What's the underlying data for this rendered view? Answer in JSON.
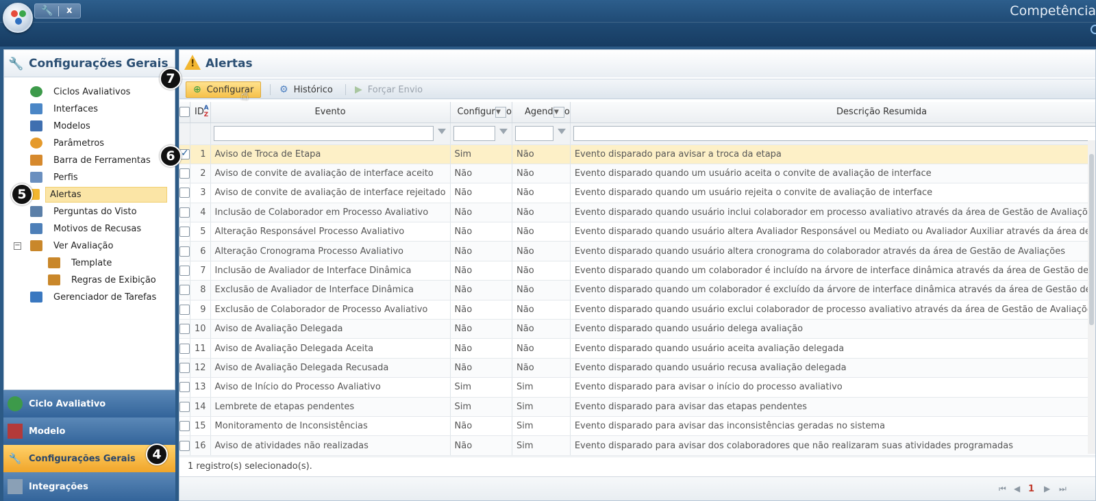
{
  "app": {
    "title": "Competência",
    "tab_close": "x"
  },
  "sidebar": {
    "title": "Configurações Gerais",
    "items": [
      {
        "label": "Ciclos Avaliativos",
        "icon": "cycle-icon",
        "color": "#3d9a4a"
      },
      {
        "label": "Interfaces",
        "icon": "pencil-doc-icon",
        "color": "#4a86c6"
      },
      {
        "label": "Modelos",
        "icon": "model-icon",
        "color": "#3f6fb0"
      },
      {
        "label": "Parâmetros",
        "icon": "pie-icon",
        "color": "#e59a2b"
      },
      {
        "label": "Barra de Ferramentas",
        "icon": "toolbox-icon",
        "color": "#d6892d"
      },
      {
        "label": "Perfis",
        "icon": "profile-icon",
        "color": "#6a8fbf"
      },
      {
        "label": "Alertas",
        "icon": "warning-icon",
        "color": "#f2b630"
      },
      {
        "label": "Perguntas do Visto",
        "icon": "question-doc-icon",
        "color": "#5b7fa8"
      },
      {
        "label": "Motivos de Recusas",
        "icon": "refuse-icon",
        "color": "#4d7fb8"
      },
      {
        "label": "Ver Avaliação",
        "icon": "clipboard-icon",
        "color": "#c9872a"
      },
      {
        "label": "Template",
        "icon": "clipboard-icon",
        "color": "#c9872a"
      },
      {
        "label": "Regras de Exibição",
        "icon": "clipboard-icon",
        "color": "#c9872a"
      },
      {
        "label": "Gerenciador de Tarefas",
        "icon": "task-manager-icon",
        "color": "#3a78c0"
      }
    ]
  },
  "accordion": [
    {
      "label": "Ciclo Avaliativo",
      "icon": "cycle-icon"
    },
    {
      "label": "Modelo",
      "icon": "books-icon"
    },
    {
      "label": "Configurações Gerais",
      "icon": "wrench-icon"
    },
    {
      "label": "Integrações",
      "icon": "integration-icon"
    }
  ],
  "main": {
    "title": "Alertas",
    "toolbar": {
      "configurar": "Configurar",
      "historico": "Histórico",
      "forcar_envio": "Forçar Envio"
    },
    "columns": {
      "id": "ID",
      "evento": "Evento",
      "configurado": "Configurado",
      "agendado": "Agendado",
      "descricao": "Descrição Resumida"
    },
    "rows": [
      {
        "id": "1",
        "evento": "Aviso de Troca de Etapa",
        "configurado": "Sim",
        "agendado": "Não",
        "descricao": "Evento disparado para avisar a troca da etapa",
        "checked": true
      },
      {
        "id": "2",
        "evento": "Aviso de convite de avaliação de interface aceito",
        "configurado": "Não",
        "agendado": "Não",
        "descricao": "Evento disparado quando um usuário aceita o convite de avaliação de interface"
      },
      {
        "id": "3",
        "evento": "Aviso de convite de avaliação de interface rejeitado",
        "configurado": "Não",
        "agendado": "Não",
        "descricao": "Evento disparado quando um usuário rejeita o convite de avaliação de interface"
      },
      {
        "id": "4",
        "evento": "Inclusão de Colaborador em Processo Avaliativo",
        "configurado": "Não",
        "agendado": "Não",
        "descricao": "Evento disparado quando usuário inclui colaborador em processo avaliativo através da área de Gestão de Avaliações"
      },
      {
        "id": "5",
        "evento": "Alteração Responsável Processo Avaliativo",
        "configurado": "Não",
        "agendado": "Não",
        "descricao": "Evento disparado quando usuário altera Avaliador Responsável ou Mediato ou Avaliador Auxiliar através da área de Gestão de Avaliações"
      },
      {
        "id": "6",
        "evento": "Alteração Cronograma Processo Avaliativo",
        "configurado": "Não",
        "agendado": "Não",
        "descricao": "Evento disparado quando usuário altera cronograma do colaborador através da área de Gestão de Avaliações"
      },
      {
        "id": "7",
        "evento": "Inclusão de Avaliador de Interface Dinâmica",
        "configurado": "Não",
        "agendado": "Não",
        "descricao": "Evento disparado quando um colaborador é incluído na árvore de interface dinâmica através da área de Gestão de Avaliações"
      },
      {
        "id": "8",
        "evento": "Exclusão de Avaliador de Interface Dinâmica",
        "configurado": "Não",
        "agendado": "Não",
        "descricao": "Evento disparado quando um colaborador é excluído da árvore de interface dinâmica através da área de Gestão de Avaliações"
      },
      {
        "id": "9",
        "evento": "Exclusão de Colaborador de Processo Avaliativo",
        "configurado": "Não",
        "agendado": "Não",
        "descricao": "Evento disparado quando usuário exclui colaborador de processo avaliativo através da área de Gestão de Avaliações"
      },
      {
        "id": "10",
        "evento": "Aviso de Avaliação Delegada",
        "configurado": "Não",
        "agendado": "Não",
        "descricao": "Evento disparado quando usuário delega avaliação"
      },
      {
        "id": "11",
        "evento": "Aviso de Avaliação Delegada Aceita",
        "configurado": "Não",
        "agendado": "Não",
        "descricao": "Evento disparado quando usuário aceita avaliação delegada"
      },
      {
        "id": "12",
        "evento": "Aviso de Avaliação Delegada Recusada",
        "configurado": "Não",
        "agendado": "Não",
        "descricao": "Evento disparado quando usuário recusa avaliação delegada"
      },
      {
        "id": "13",
        "evento": "Aviso de Início do Processo Avaliativo",
        "configurado": "Sim",
        "agendado": "Sim",
        "descricao": "Evento disparado para avisar o início do processo avaliativo"
      },
      {
        "id": "14",
        "evento": "Lembrete de etapas pendentes",
        "configurado": "Sim",
        "agendado": "Sim",
        "descricao": "Evento disparado para avisar das etapas pendentes"
      },
      {
        "id": "15",
        "evento": "Monitoramento de Inconsistências",
        "configurado": "Não",
        "agendado": "Sim",
        "descricao": "Evento disparado para avisar das inconsistências geradas no sistema"
      },
      {
        "id": "16",
        "evento": "Aviso de atividades não realizadas",
        "configurado": "Não",
        "agendado": "Sim",
        "descricao": "Evento disparado para avisar dos colaboradores que não realizaram suas atividades programadas"
      }
    ],
    "status": "1 registro(s) selecionado(s).",
    "pager": {
      "page": "1"
    }
  },
  "callouts": [
    "7",
    "6",
    "5",
    "4"
  ]
}
